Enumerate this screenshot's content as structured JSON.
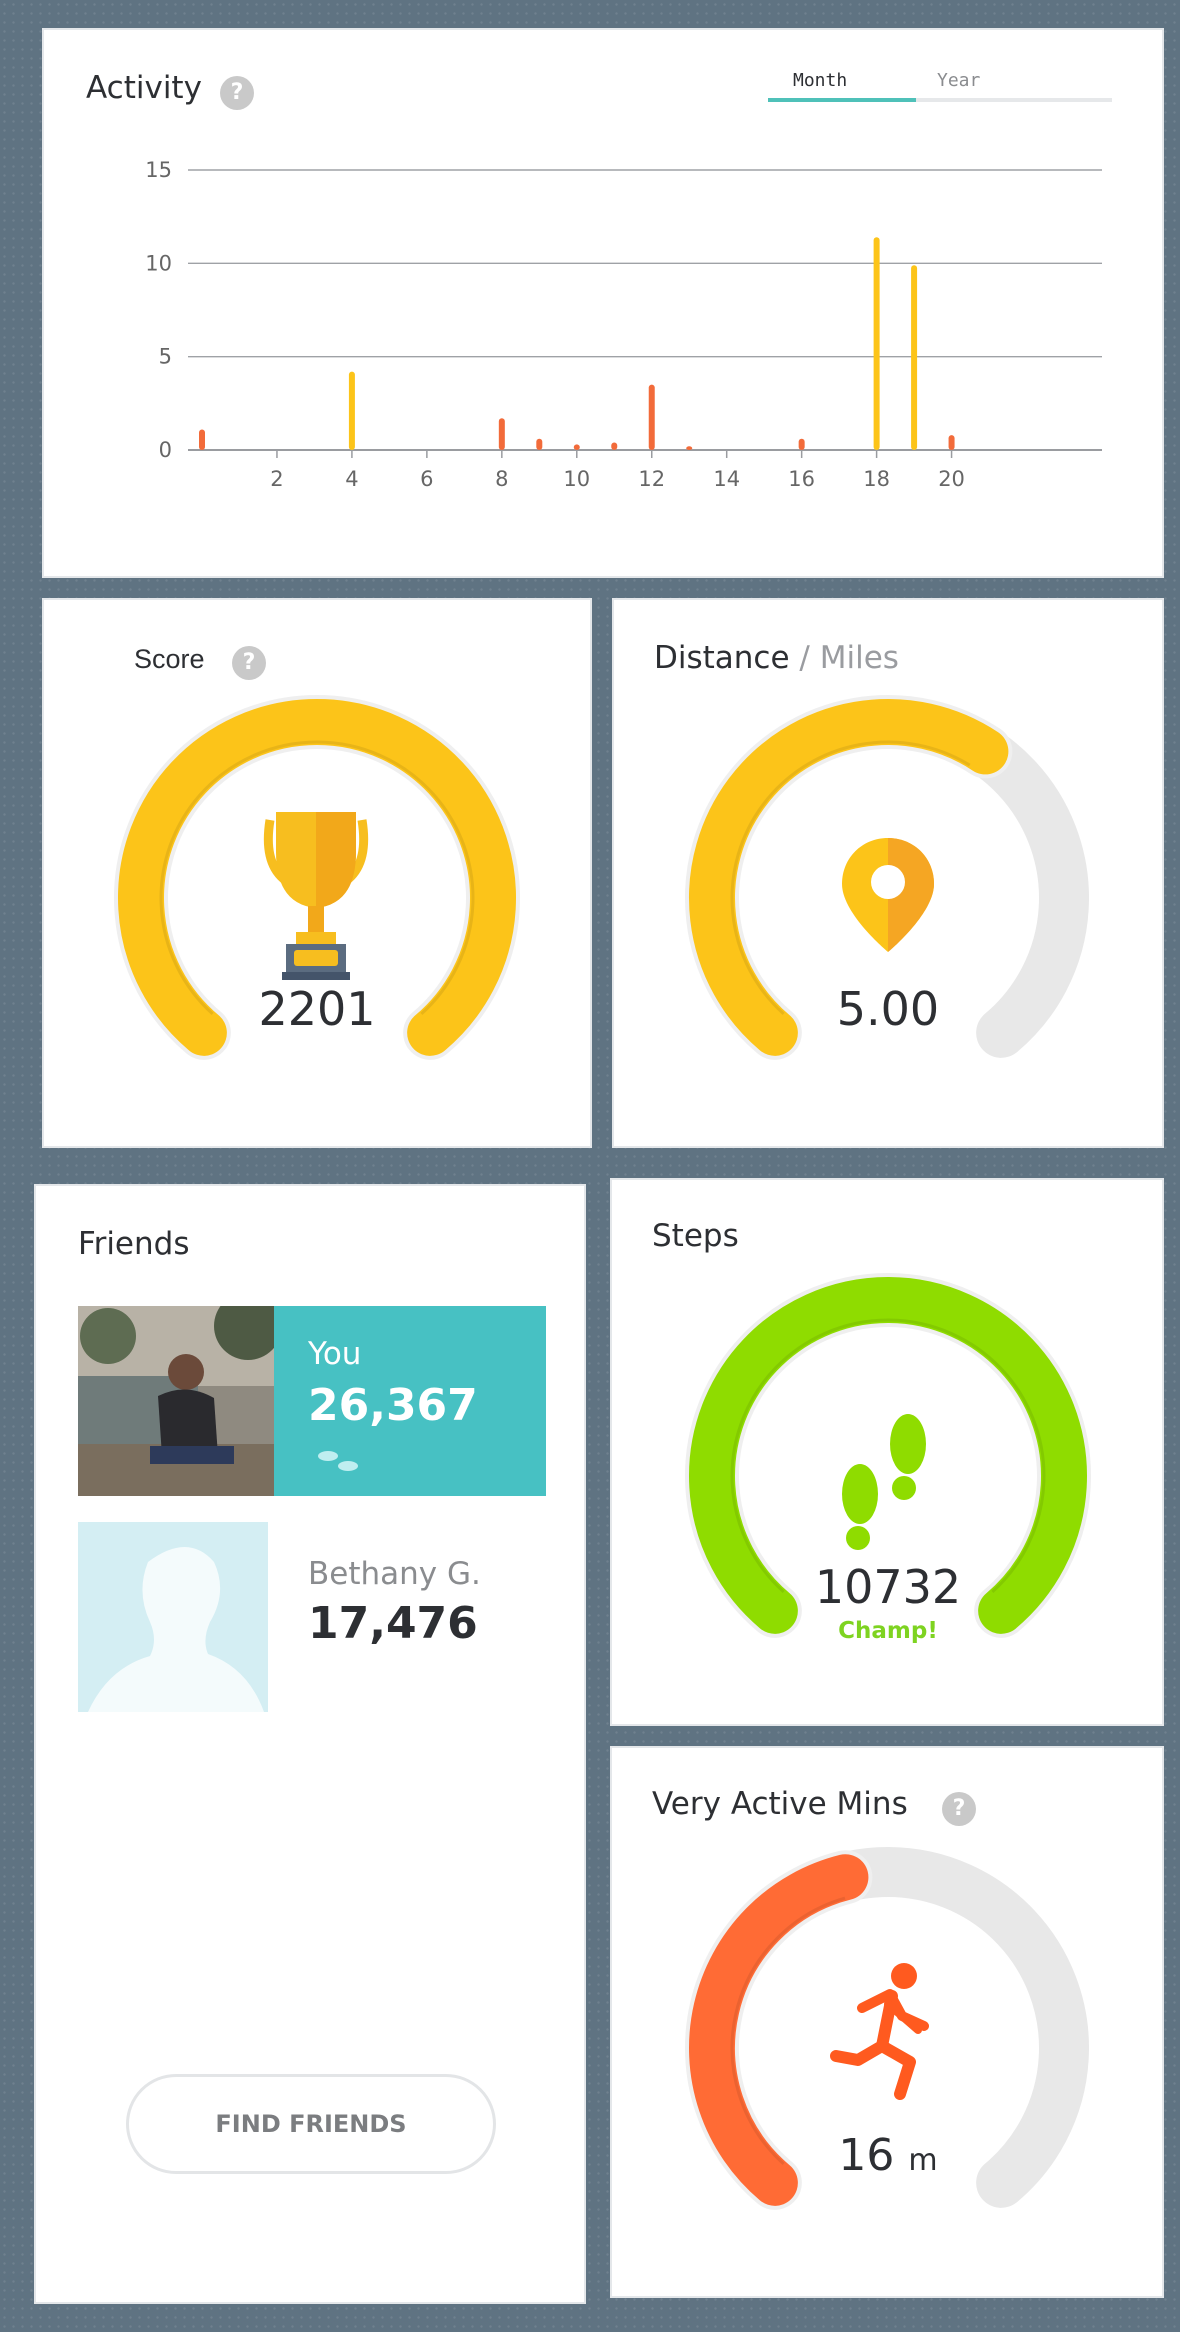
{
  "activity": {
    "title": "Activity",
    "help_icon": "question-icon",
    "tabs": [
      {
        "label": "Month",
        "active": true
      },
      {
        "label": "Year",
        "active": false
      }
    ],
    "accent_color": "#4fc1b9"
  },
  "chart_data": {
    "type": "bar",
    "ylim": [
      0,
      15
    ],
    "yticks": [
      0,
      5,
      10,
      15
    ],
    "xticks": [
      2,
      4,
      6,
      8,
      10,
      12,
      14,
      16,
      18,
      20
    ],
    "grid": true,
    "x": [
      0,
      4,
      8,
      9,
      10,
      11,
      12,
      13,
      16,
      18,
      19,
      20
    ],
    "values": [
      1.1,
      4.2,
      1.7,
      0.6,
      0.3,
      0.4,
      3.5,
      0.2,
      0.6,
      11.4,
      9.9,
      0.8
    ],
    "colors": [
      "#f26b3a",
      "#fcc419",
      "#f26b3a",
      "#f26b3a",
      "#f26b3a",
      "#f26b3a",
      "#f26b3a",
      "#f26b3a",
      "#f26b3a",
      "#fcc419",
      "#fcc419",
      "#f26b3a"
    ]
  },
  "score": {
    "title": "Score",
    "help_icon": "question-icon",
    "value": "2201",
    "progress": 1.0,
    "color": "#fcc419",
    "icon": "trophy-icon"
  },
  "distance": {
    "title": "Distance",
    "unit": "/ Miles",
    "value": "5.00",
    "progress": 0.62,
    "color": "#fcc419",
    "icon": "location-pin-icon"
  },
  "friends": {
    "title": "Friends",
    "list": [
      {
        "name": "You",
        "steps": "26,367",
        "highlight_color": "#47c1c3"
      },
      {
        "name": "Bethany G.",
        "steps": "17,476"
      }
    ],
    "find_label": "FIND FRIENDS"
  },
  "steps": {
    "title": "Steps",
    "value": "10732",
    "status": "Champ!",
    "progress": 1.0,
    "color": "#8fdc00",
    "icon": "footprints-icon"
  },
  "very_active": {
    "title": "Very Active Mins",
    "help_icon": "question-icon",
    "value": "16",
    "unit": "m",
    "progress": 0.45,
    "color": "#ff6b35",
    "icon": "running-person-icon"
  }
}
